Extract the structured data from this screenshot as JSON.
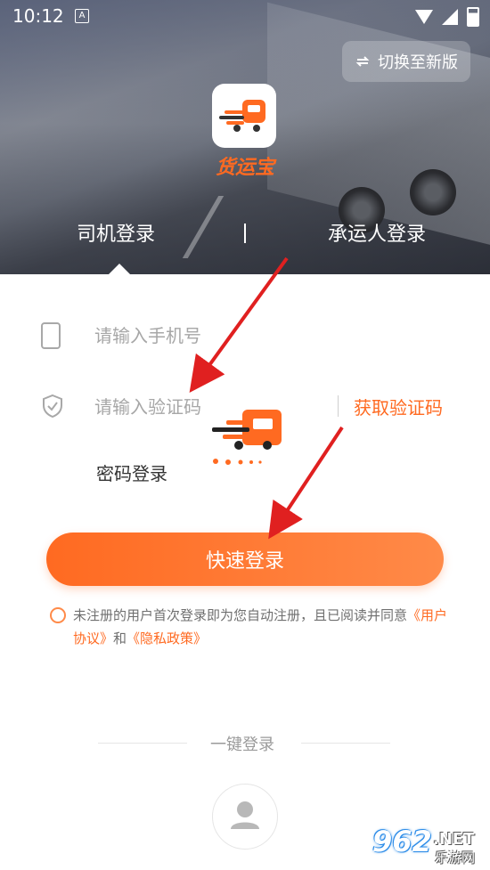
{
  "status_bar": {
    "time": "10:12",
    "notification_letter": "A"
  },
  "header": {
    "switch_label": "切换至新版",
    "switch_icon": "swap-arrows-icon",
    "app_name": "货运宝",
    "tabs": [
      {
        "label": "司机登录",
        "selected": true
      },
      {
        "label": "承运人登录",
        "selected": false
      }
    ]
  },
  "form": {
    "phone_placeholder": "请输入手机号",
    "code_placeholder": "请输入验证码",
    "get_code_label": "获取验证码",
    "password_login_label": "密码登录",
    "login_button_label": "快速登录"
  },
  "agreement": {
    "text_prefix": "未注册的用户首次登录即为您自动注册，且已阅读并同意",
    "link1": "《用户协议》",
    "and": "和",
    "link2": "《隐私政策》"
  },
  "onekey": {
    "label": "一键登录"
  },
  "watermark": {
    "number": "962",
    "suffix": ".NET",
    "subtitle": "乐游网"
  },
  "colors": {
    "accent": "#ff6a21",
    "annotation_arrow": "#e02020"
  }
}
